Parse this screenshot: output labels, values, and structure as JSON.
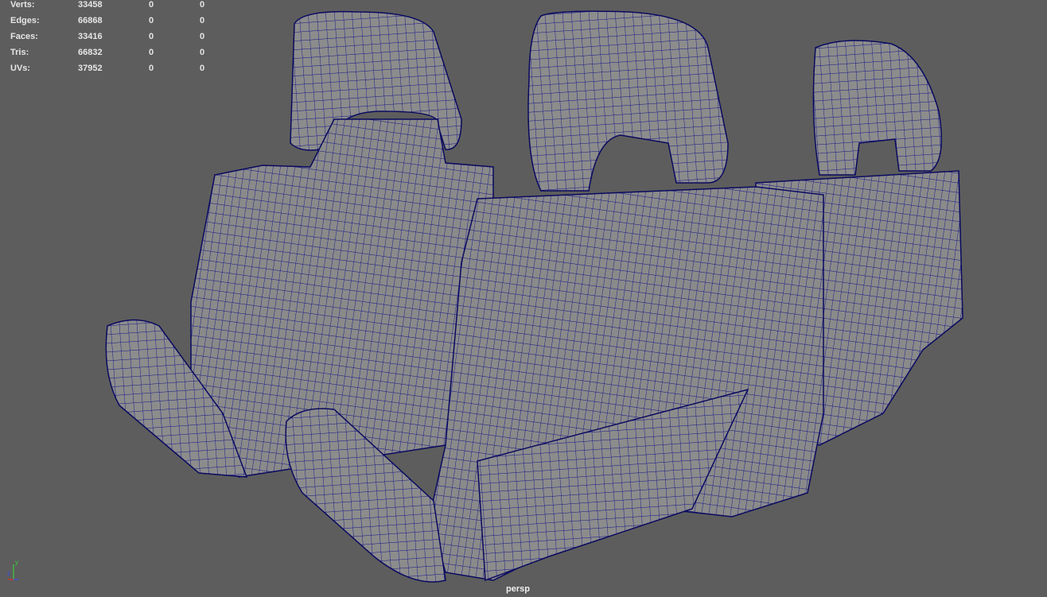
{
  "hud": {
    "rows": [
      {
        "label": "Verts:",
        "values": [
          "33458",
          "0",
          "0"
        ]
      },
      {
        "label": "Edges:",
        "values": [
          "66868",
          "0",
          "0"
        ]
      },
      {
        "label": "Faces:",
        "values": [
          "33416",
          "0",
          "0"
        ]
      },
      {
        "label": "Tris:",
        "values": [
          "66832",
          "0",
          "0"
        ]
      },
      {
        "label": "UVs:",
        "values": [
          "37952",
          "0",
          "0"
        ]
      }
    ]
  },
  "camera_name": "persp",
  "axis": {
    "y": "y",
    "z": "z"
  },
  "colors": {
    "background": "#5d5d5d",
    "mesh_fill": "#8c8c8c",
    "wireframe": "#14148a"
  }
}
